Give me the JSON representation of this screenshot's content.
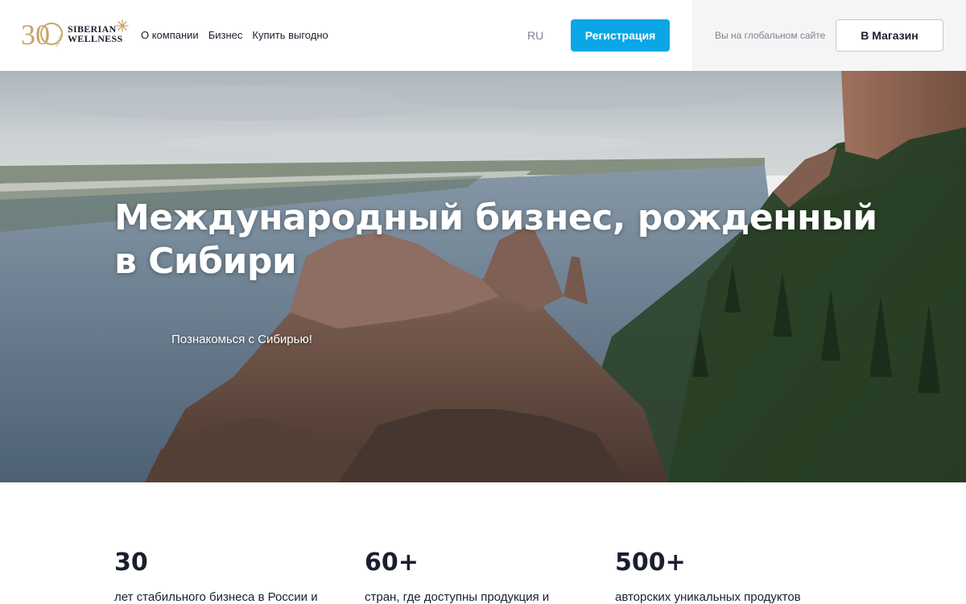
{
  "header": {
    "logo": {
      "badge": "30",
      "badge_sub": "YEARS",
      "line1": "SIBERIAN",
      "line2": "WELLNESS"
    },
    "nav": [
      "О компании",
      "Бизнес",
      "Купить выгодно"
    ],
    "lang": "RU",
    "register_label": "Регистрация",
    "global_site_text": "Вы на глобальном сайте",
    "store_label": "В Магазин"
  },
  "hero": {
    "title": "Международный бизнес, рожденный в Сибири",
    "link": "Познакомься с Сибирью!"
  },
  "stats": [
    {
      "value": "30",
      "desc": "лет стабильного бизнеса в России и"
    },
    {
      "value": "60+",
      "desc": "стран, где доступны продукция и"
    },
    {
      "value": "500+",
      "desc": "авторских уникальных продуктов"
    }
  ],
  "colors": {
    "accent": "#0aa6e6",
    "text": "#1a1f2e",
    "muted": "#7d8390",
    "gold": "#c9a46a"
  }
}
